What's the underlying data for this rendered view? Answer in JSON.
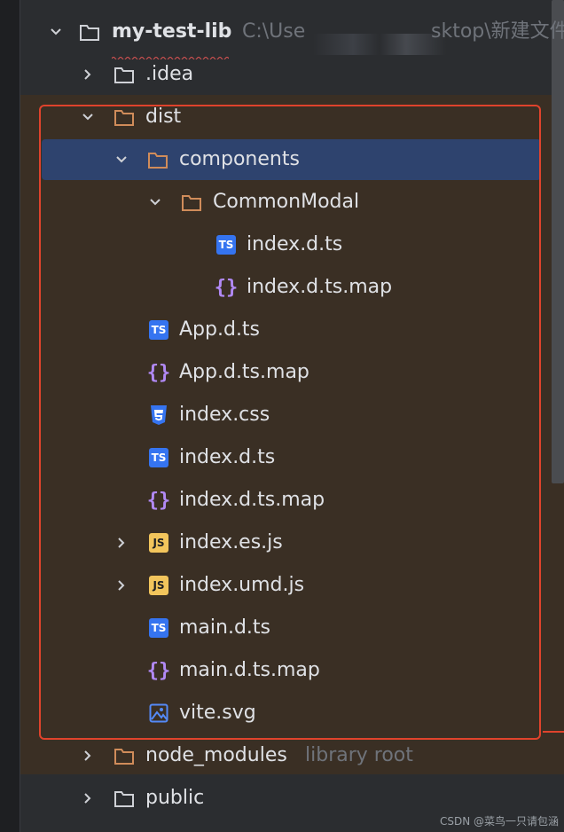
{
  "tree": {
    "root": {
      "label": "my-test-lib",
      "path_start": "C:\\Use",
      "path_end": "sktop\\新建文件"
    },
    "rows": [
      {
        "label": ".idea",
        "icon": "folder-icon"
      },
      {
        "label": "dist",
        "icon": "folder-excluded-icon"
      },
      {
        "label": "components",
        "icon": "folder-excluded-icon"
      },
      {
        "label": "CommonModal",
        "icon": "folder-excluded-icon"
      },
      {
        "label": "index.d.ts",
        "icon": "typescript-icon"
      },
      {
        "label": "index.d.ts.map",
        "icon": "json-braces-icon"
      },
      {
        "label": "App.d.ts",
        "icon": "typescript-icon"
      },
      {
        "label": "App.d.ts.map",
        "icon": "json-braces-icon"
      },
      {
        "label": "index.css",
        "icon": "css-icon"
      },
      {
        "label": "index.d.ts",
        "icon": "typescript-icon"
      },
      {
        "label": "index.d.ts.map",
        "icon": "json-braces-icon"
      },
      {
        "label": "index.es.js",
        "icon": "javascript-icon"
      },
      {
        "label": "index.umd.js",
        "icon": "javascript-icon"
      },
      {
        "label": "main.d.ts",
        "icon": "typescript-icon"
      },
      {
        "label": "main.d.ts.map",
        "icon": "json-braces-icon"
      },
      {
        "label": "vite.svg",
        "icon": "image-icon"
      },
      {
        "label": "node_modules",
        "hint": "library root",
        "icon": "folder-excluded-icon"
      },
      {
        "label": "public",
        "icon": "folder-icon"
      }
    ],
    "badges": {
      "ts": "TS",
      "js": "JS",
      "braces": "{}"
    }
  },
  "colors": {
    "selection": "#2e436e",
    "excluded_bg": "#3a2f24",
    "highlight_box": "#e0432c",
    "folder_excluded": "#d08c5a",
    "folder": "#cfd1d6"
  },
  "watermark": "CSDN @菜鸟一只请包涵"
}
